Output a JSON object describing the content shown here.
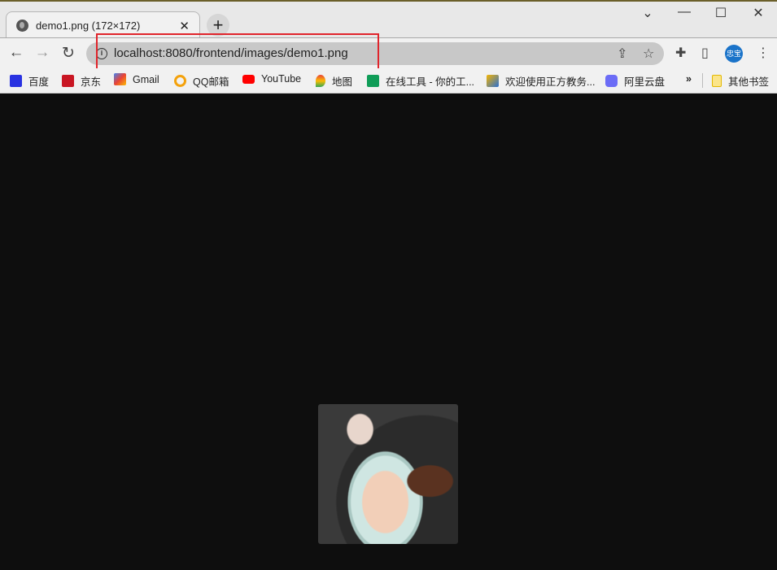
{
  "tab": {
    "title": "demo1.png (172×172)",
    "close": "✕",
    "new_tab": "+"
  },
  "window": {
    "dropdown": "⌄",
    "minimize": "—",
    "maximize": "☐",
    "close": "✕"
  },
  "toolbar": {
    "back": "←",
    "forward": "→",
    "reload": "↻",
    "url": "localhost:8080/frontend/images/demo1.png",
    "share": "⇪",
    "star": "☆",
    "extensions": "✚",
    "sidepanel": "▯",
    "avatar": "忠宝",
    "menu": "⋮"
  },
  "bookmarks": [
    {
      "label": "百度",
      "color": "#2932e1"
    },
    {
      "label": "京东",
      "color": "#c91623"
    },
    {
      "label": "Gmail",
      "color": "#ea4335"
    },
    {
      "label": "QQ邮箱",
      "color": "#f4a20c"
    },
    {
      "label": "YouTube",
      "color": "#ff0000"
    },
    {
      "label": "地图",
      "color": "#34a853"
    },
    {
      "label": "在线工具 - 你的工...",
      "color": "#109d58"
    },
    {
      "label": "欢迎使用正方教务...",
      "color": "#2a6fd1"
    },
    {
      "label": "阿里云盘",
      "color": "#6b6cf6"
    }
  ],
  "bookmarks_overflow": "»",
  "other_bookmarks": {
    "label": "其他书签",
    "color": "#f6d23e"
  },
  "highlight_color": "#e0242b"
}
